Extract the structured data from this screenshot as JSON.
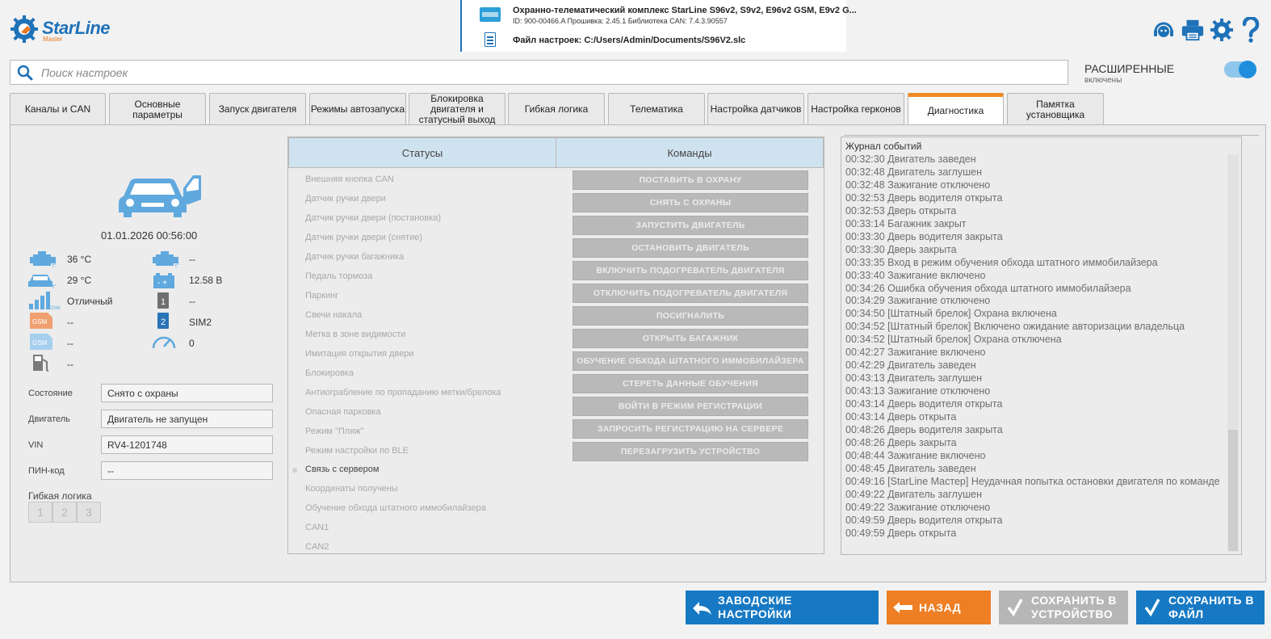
{
  "header": {
    "logo_text": "StarLine",
    "logo_sub": "Master",
    "device_title": "Охранно-телематический комплекс StarLine S96v2, S9v2, E96v2 GSM, E9v2 G...",
    "device_meta": "ID: 900-00466.A   Прошивка: 2.45.1   Библиотека CAN: 7.4.3.90557",
    "settings_file": "Файл настроек: C:/Users/Admin/Documents/S96V2.slc",
    "icons": [
      "support-icon",
      "print-icon",
      "gear-icon",
      "help-icon"
    ]
  },
  "search": {
    "placeholder": "Поиск настроек"
  },
  "advanced": {
    "label": "РАСШИРЕННЫЕ",
    "sub": "включены",
    "enabled": true
  },
  "tabs": [
    "Каналы и CAN",
    "Основные параметры",
    "Запуск двигателя",
    "Режимы автозапуска",
    "Блокировка двигателя и статусный выход",
    "Гибкая логика",
    "Телематика",
    "Настройка датчиков",
    "Настройка герконов",
    "Диагностика",
    "Памятка установщика"
  ],
  "active_tab": "Диагностика",
  "left": {
    "datetime": "01.01.2026  00:56:00",
    "metrics": {
      "engine_temp": "36 °C",
      "engine_temp2": "--",
      "cabin_temp": "29 °C",
      "battery": "12.58 В",
      "gsm_signal": "Отличный",
      "sim1": "--",
      "gsm1": "--",
      "sim2": "SIM2",
      "gsm2": "--",
      "speed": "0",
      "fuel": "--"
    },
    "fields": {
      "state_label": "Состояние",
      "state_value": "Снято с охраны",
      "engine_label": "Двигатель",
      "engine_value": "Двигатель не запущен",
      "vin_label": "VIN",
      "vin_value": "RV4-1201748",
      "pin_label": "ПИН-код",
      "pin_value": "--"
    },
    "flex_logic_label": "Гибкая логика",
    "flex_buttons": [
      "1",
      "2",
      "3"
    ]
  },
  "statuses": {
    "header": "Статусы",
    "items": [
      "Внешняя кнопка CAN",
      "Датчик ручки двери",
      "Датчик ручки двери (постановка)",
      "Датчик ручки двери (снятие)",
      "Датчик ручки багажника",
      "Педаль тормоза",
      "Паркинг",
      "Свечи накала",
      "Метка в зоне видимости",
      "Имитация открытия двери",
      "Блокировка",
      "Антиограбление по пропаданию метки/брелока",
      "Опасная парковка",
      "Режим \"Пляж\"",
      "Режим настройки по BLE",
      "Связь с сервером",
      "Координаты получены",
      "Обучение обхода штатного иммобилайзера",
      "CAN1",
      "CAN2"
    ]
  },
  "commands": {
    "header": "Команды",
    "items": [
      "ПОСТАВИТЬ В ОХРАНУ",
      "СНЯТЬ С ОХРАНЫ",
      "ЗАПУСТИТЬ ДВИГАТЕЛЬ",
      "ОСТАНОВИТЬ ДВИГАТЕЛЬ",
      "ВКЛЮЧИТЬ ПОДОГРЕВАТЕЛЬ ДВИГАТЕЛЯ",
      "ОТКЛЮЧИТЬ ПОДОГРЕВАТЕЛЬ ДВИГАТЕЛЯ",
      "ПОСИГНАЛИТЬ",
      "ОТКРЫТЬ БАГАЖНИК",
      "ОБУЧЕНИЕ ОБХОДА ШТАТНОГО ИММОБИЛАЙЗЕРА",
      "СТЕРЕТЬ ДАННЫЕ ОБУЧЕНИЯ",
      "ВОЙТИ В РЕЖИМ РЕГИСТРАЦИИ",
      "ЗАПРОСИТЬ РЕГИСТРАЦИЮ НА СЕРВЕРЕ",
      "ПЕРЕЗАГРУЗИТЬ УСТРОЙСТВО"
    ]
  },
  "log": {
    "title": "Журнал событий",
    "lines": [
      "00:32:30  Двигатель заведен",
      "00:32:48  Двигатель заглушен",
      "00:32:48  Зажигание отключено",
      "00:32:53  Дверь водителя открыта",
      "00:32:53  Дверь открыта",
      "00:33:14  Багажник закрыт",
      "00:33:30  Дверь водителя закрыта",
      "00:33:30  Дверь закрыта",
      "00:33:35  Вход в режим обучения обхода штатного иммобилайзера",
      "00:33:40  Зажигание включено",
      "00:34:26  Ошибка обучения обхода штатного иммобилайзера",
      "00:34:29  Зажигание отключено",
      "00:34:50  [Штатный брелок] Охрана включена",
      "00:34:52  [Штатный брелок] Включено ожидание авторизации владельца",
      "00:34:52  [Штатный брелок] Охрана отключена",
      "00:42:27  Зажигание включено",
      "00:42:29  Двигатель заведен",
      "00:43:13  Двигатель заглушен",
      "00:43:13  Зажигание отключено",
      "00:43:14  Дверь водителя открыта",
      "00:43:14  Дверь открыта",
      "00:48:26  Дверь водителя закрыта",
      "00:48:26  Дверь закрыта",
      "00:48:44  Зажигание включено",
      "00:48:45  Двигатель заведен",
      "00:49:16  [StarLine Мастер] Неудачная попытка остановки двигателя по команде",
      "00:49:22  Двигатель заглушен",
      "00:49:22  Зажигание отключено",
      "00:49:59  Дверь водителя открыта",
      "00:49:59  Дверь открыта"
    ]
  },
  "footer": {
    "factory_line1": "ЗАВОДСКИЕ",
    "factory_line2": "НАСТРОЙКИ",
    "back": "НАЗАД",
    "save_device_line1": "СОХРАНИТЬ В",
    "save_device_line2": "УСТРОЙСТВО",
    "save_file_line1": "СОХРАНИТЬ В",
    "save_file_line2": "ФАЙЛ"
  },
  "colors": {
    "brand_blue": "#1779c4",
    "accent_orange": "#ee7f24",
    "disabled_gray": "#b6b6b6",
    "header_cell": "#cfe2ef"
  }
}
